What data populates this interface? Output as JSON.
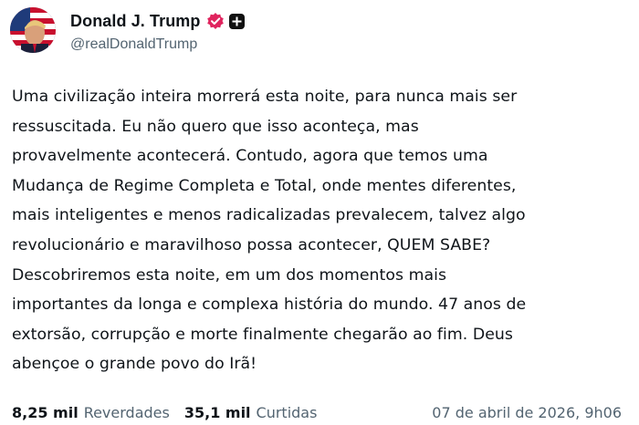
{
  "author": {
    "display_name": "Donald J. Trump",
    "handle": "@realDonaldTrump",
    "verified_icon": "verified-badge-icon",
    "extra_icon": "plus-badge-icon",
    "verified_color": "#e0245e"
  },
  "post": {
    "text": "Uma civilização inteira morrerá esta noite, para nunca mais ser\nressuscitada. Eu não quero que isso aconteça, mas\nprovavelmente acontecerá. Contudo, agora que temos uma\nMudança de Regime Completa e Total, onde mentes diferentes,\nmais inteligentes e menos radicalizadas prevalecem, talvez algo\nrevolucionário e maravilhoso possa acontecer, QUEM SABE?\nDescobriremos esta noite, em um dos momentos mais\nimportantes da longa e complexa história do mundo. 47 anos de\nextorsão, corrupção e morte finalmente chegarão ao fim. Deus\nabençoe o grande povo do Irã!"
  },
  "stats": {
    "reposts_count": "8,25 mil",
    "reposts_label": "Reverdades",
    "likes_count": "35,1 mil",
    "likes_label": "Curtidas"
  },
  "timestamp": "07 de abril de 2026, 9h06"
}
